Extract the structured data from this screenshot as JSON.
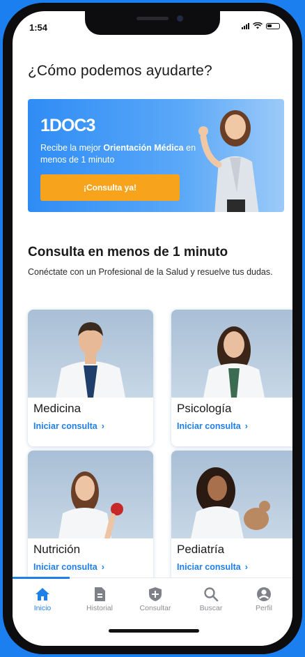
{
  "status": {
    "time": "1:54"
  },
  "header": {
    "title": "¿Cómo podemos ayudarte?"
  },
  "banner": {
    "logo": "1DOC3",
    "text_pre": "Recibe la mejor ",
    "text_bold_1": "Orientación Médica",
    "text_mid": " en menos de 1 minuto",
    "cta_label": "¡Consulta ya!"
  },
  "section": {
    "title": "Consulta en menos de 1 minuto",
    "subtitle": "Conéctate con un Profesional de la Salud y resuelve tus dudas."
  },
  "cards": [
    {
      "name": "Medicina",
      "action": "Iniciar consulta"
    },
    {
      "name": "Psicología",
      "action": "Iniciar consulta"
    },
    {
      "name": "Nutrición",
      "action": "Iniciar consulta"
    },
    {
      "name": "Pediatría",
      "action": "Iniciar consulta"
    }
  ],
  "tabs": [
    {
      "label": "Inicio",
      "icon": "home-icon",
      "active": true
    },
    {
      "label": "Historial",
      "icon": "history-icon"
    },
    {
      "label": "Consultar",
      "icon": "shield-plus-icon"
    },
    {
      "label": "Buscar",
      "icon": "search-icon"
    },
    {
      "label": "Perfil",
      "icon": "profile-icon"
    }
  ],
  "colors": {
    "accent": "#1f7fe8",
    "cta": "#f7a31c",
    "background": "#1b7ff0"
  }
}
